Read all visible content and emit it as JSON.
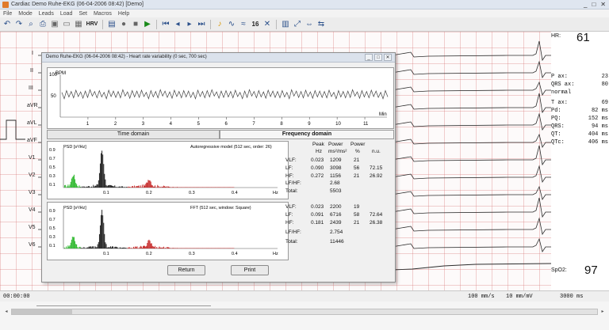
{
  "window": {
    "title": "Cardiac  Demo Ruhe-EKG (06-04-2006 08:42)  [Demo]",
    "controls": [
      "_",
      "□",
      "✕"
    ]
  },
  "menu": [
    "File",
    "Mode",
    "Leads",
    "Load",
    "Set",
    "Macros",
    "Help"
  ],
  "toolbar": {
    "hrv_label": "HRV",
    "speed_label": "16"
  },
  "leads": [
    "I",
    "II",
    "III",
    "aVR",
    "aVL",
    "aVF",
    "V1",
    "V2",
    "V3",
    "V4",
    "V5",
    "V6"
  ],
  "side": {
    "hr_label": "HR:",
    "hr_value": "61",
    "measurements": [
      {
        "label": "P ax:",
        "value": "23"
      },
      {
        "label": "QRS ax:",
        "value": "80"
      },
      {
        "label": "normal",
        "value": ""
      },
      {
        "label": "T ax:",
        "value": "69"
      },
      {
        "label": "Pd:",
        "value": "82 ms"
      },
      {
        "label": "PQ:",
        "value": "152 ms"
      },
      {
        "label": "QRS:",
        "value": "94 ms"
      },
      {
        "label": "QT:",
        "value": "404 ms"
      },
      {
        "label": "QTc:",
        "value": "406 ms"
      }
    ],
    "spo2_label": "SpO2:",
    "spo2_value": "97"
  },
  "status": {
    "time": "00:00:00",
    "paper_speed": "100 mm/s",
    "gain": "10 mm/mV",
    "duration": "3000 ms"
  },
  "dialog": {
    "title": "Demo Ruhe-EKG (06-04-2006 08:42) - Heart rate variability (0 sec, 700 sec)",
    "controls": [
      "_",
      "□",
      "✕"
    ],
    "bpm": {
      "ylabel": "BPM",
      "y_ticks": [
        "100",
        "50"
      ],
      "xunit": "Min",
      "x_ticks": [
        "1",
        "2",
        "3",
        "4",
        "5",
        "6",
        "7",
        "8",
        "9",
        "10",
        "11"
      ],
      "values": [
        58,
        62,
        60,
        63,
        59,
        61,
        64,
        60,
        62,
        58,
        63,
        61,
        60,
        64,
        59,
        62,
        61,
        63,
        58,
        62,
        60,
        64,
        61,
        59,
        63,
        60,
        62,
        61,
        58,
        63,
        60,
        62,
        64,
        59,
        61,
        62,
        60,
        63,
        58,
        61,
        64,
        60,
        62,
        59,
        63,
        61,
        60,
        62,
        58,
        64,
        61,
        60,
        63,
        59,
        62,
        61,
        60,
        63,
        58,
        62,
        60,
        61,
        64,
        59,
        62,
        60,
        63,
        61,
        58,
        62
      ]
    },
    "tabs": {
      "time_domain": "Time domain",
      "frequency_domain": "Frequency domain"
    },
    "ar_chart": {
      "ylabel": "PSD [s²/Hz]",
      "title": "Autoregressive model (512 sec, order: 26)",
      "y_ticks": [
        "0.9",
        "0.7",
        "0.5",
        "0.3",
        "0.1"
      ],
      "x_ticks": [
        "0.1",
        "0.2",
        "0.3",
        "0.4"
      ],
      "xunit": "Hz"
    },
    "fft_chart": {
      "ylabel": "PSD [s²/Hz]",
      "title": "FFT (512 sec, window: Square)",
      "y_ticks": [
        "0.9",
        "0.7",
        "0.5",
        "0.3",
        "0.1"
      ],
      "x_ticks": [
        "0.1",
        "0.2",
        "0.3",
        "0.4"
      ],
      "xunit": "Hz"
    },
    "table": {
      "headers": {
        "peak": "Peak",
        "power": "Power",
        "power2": "Power",
        "hz": "Hz",
        "ms": "ms²/ms²",
        "pct": "%",
        "nu": "n.u."
      },
      "ar": [
        {
          "label": "VLF:",
          "peak": "0.023",
          "power": "1209",
          "pct": "21",
          "nu": ""
        },
        {
          "label": "LF:",
          "peak": "0.090",
          "power": "3098",
          "pct": "56",
          "nu": "72.15"
        },
        {
          "label": "HF:",
          "peak": "0.272",
          "power": "1156",
          "pct": "21",
          "nu": "26.92"
        }
      ],
      "ar_lfhf_label": "LF/HF:",
      "ar_lfhf": "2.68",
      "ar_total_label": "Total:",
      "ar_total": "5503",
      "fft": [
        {
          "label": "VLF:",
          "peak": "0.023",
          "power": "2200",
          "pct": "19",
          "nu": ""
        },
        {
          "label": "LF:",
          "peak": "0.091",
          "power": "6716",
          "pct": "58",
          "nu": "72.64"
        },
        {
          "label": "HF:",
          "peak": "0.181",
          "power": "2439",
          "pct": "21",
          "nu": "26.38"
        }
      ],
      "fft_lfhf_label": "LF/HF:",
      "fft_lfhf": "2.754",
      "fft_total_label": "Total:",
      "fft_total": "11446"
    },
    "buttons": {
      "return": "Return",
      "print": "Print"
    }
  },
  "colors": {
    "grid": "#d67878",
    "trace": "#2b2b2b",
    "vlf": "#22b422",
    "lf": "#111111",
    "hf": "#c21a1a"
  }
}
